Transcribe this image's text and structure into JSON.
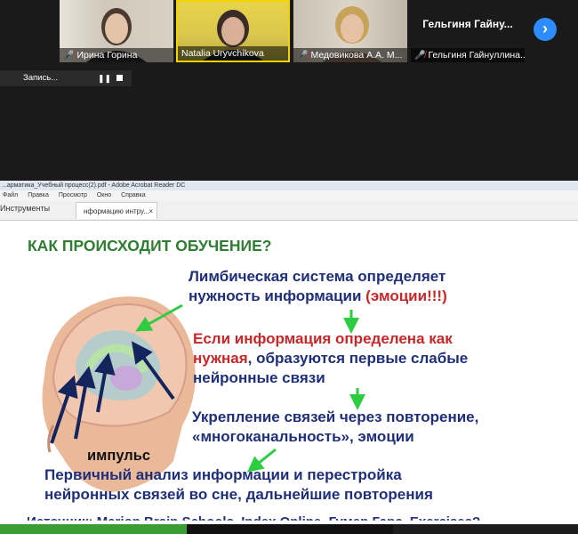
{
  "participants": [
    {
      "name": "Ирина Горина",
      "muted": true
    },
    {
      "name": "Natalia Uryvchikova",
      "muted": false
    },
    {
      "name": "Медовикова А.А. М...",
      "muted": true
    },
    {
      "name": "Гельгиня Гайнуллина...",
      "muted": true,
      "display_label": "Гельгиня  Гайну..."
    }
  ],
  "recording": {
    "label": "Запись...",
    "pause_symbol": "❚❚"
  },
  "next_page_symbol": "›",
  "shared_window": {
    "titlebar": "...арматика_Учебный процесс(2).pdf - Adobe Acrobat Reader DC",
    "menu": [
      "Файл",
      "Правка",
      "Просмотр",
      "Окно",
      "Справка"
    ],
    "tab_tools": "Инструменты",
    "tab_document": "нформацию интру...",
    "tab_close": "×"
  },
  "slide": {
    "title": "КАК ПРОИСХОДИТ ОБУЧЕНИЕ?",
    "line1a": "Лимбическая система определяет",
    "line1b": "нужность информации",
    "line1c": "(эмоции!!!)",
    "line2a": "Если информация определена как",
    "line2b": "нужная",
    "line2c": ", образуются первые слабые",
    "line2d": "нейронные связи",
    "line3a": "Укрепление связей через повторение,",
    "line3b": "«многоканальность», эмоции",
    "line4a": "Первичный анализ информации и перестройка",
    "line4b": "нейронных связей во сне, дальнейшие повторения",
    "impulse_label": "импульс",
    "cut_line": "Источник: Marion Brain Schools, Index Online, Гумер Гарс, Exercises?"
  },
  "colors": {
    "title_green": "#2e7d32",
    "text_navy": "#1f2f7a",
    "accent_red": "#c62828",
    "arrow_green": "#2ecc40",
    "zoom_blue": "#2d8cff"
  }
}
